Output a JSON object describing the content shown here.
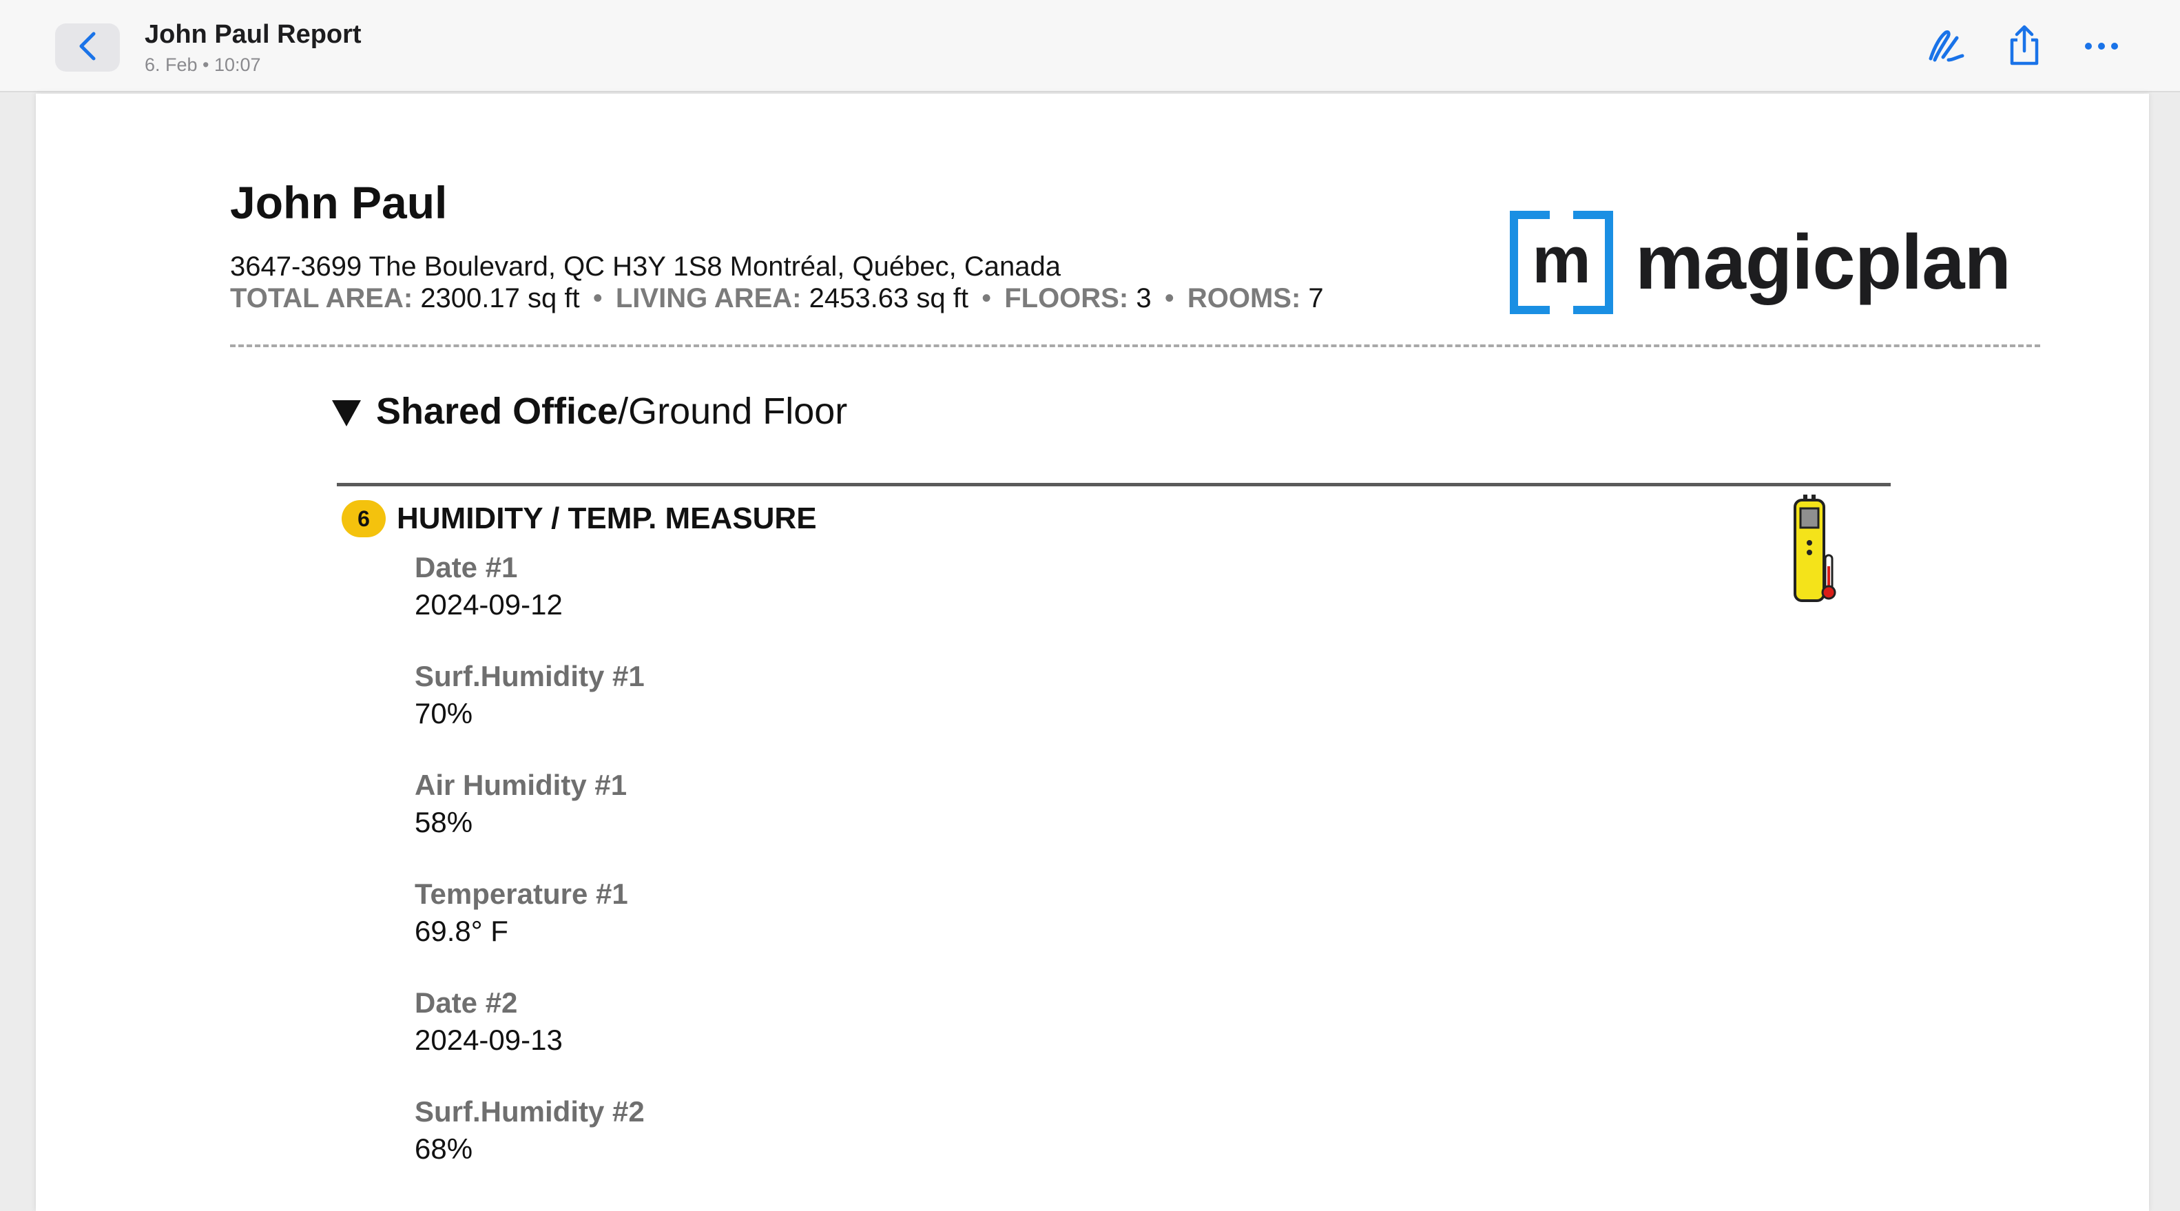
{
  "app": {
    "title": "John Paul Report",
    "subtitle": "6. Feb • 10:07",
    "icons": {
      "back": "chevron-left-icon",
      "annotate": "pen-markup-icon",
      "share": "share-icon",
      "more": "ellipsis-icon"
    },
    "accent": "#1a73e8"
  },
  "report": {
    "client_name": "John Paul",
    "address": "3647-3699 The Boulevard, QC H3Y 1S8 Montréal, Québec, Canada",
    "stats": {
      "total_area_label": "TOTAL AREA:",
      "total_area_value": "2300.17 sq ft",
      "living_area_label": "LIVING AREA:",
      "living_area_value": "2453.63 sq ft",
      "floors_label": "FLOORS:",
      "floors_value": "3",
      "rooms_label": "ROOMS:",
      "rooms_value": "7",
      "separator": "•"
    },
    "logo": {
      "mark_letter": "m",
      "text": "magicplan",
      "color": "#1a8fe3"
    },
    "section": {
      "room": "Shared Office",
      "floor": "/Ground Floor"
    },
    "item": {
      "badge": "6",
      "badge_color": "#f4c20d",
      "title": "HUMIDITY / TEMP. MEASURE",
      "icon": "humidity-meter-icon",
      "fields": [
        {
          "label": "Date #1",
          "value": "2024-09-12"
        },
        {
          "label": "Surf.Humidity #1",
          "value": "70%"
        },
        {
          "label": "Air Humidity #1",
          "value": "58%"
        },
        {
          "label": "Temperature #1",
          "value": "69.8° F"
        },
        {
          "label": "Date #2",
          "value": "2024-09-13"
        },
        {
          "label": "Surf.Humidity #2",
          "value": "68%"
        }
      ]
    }
  }
}
